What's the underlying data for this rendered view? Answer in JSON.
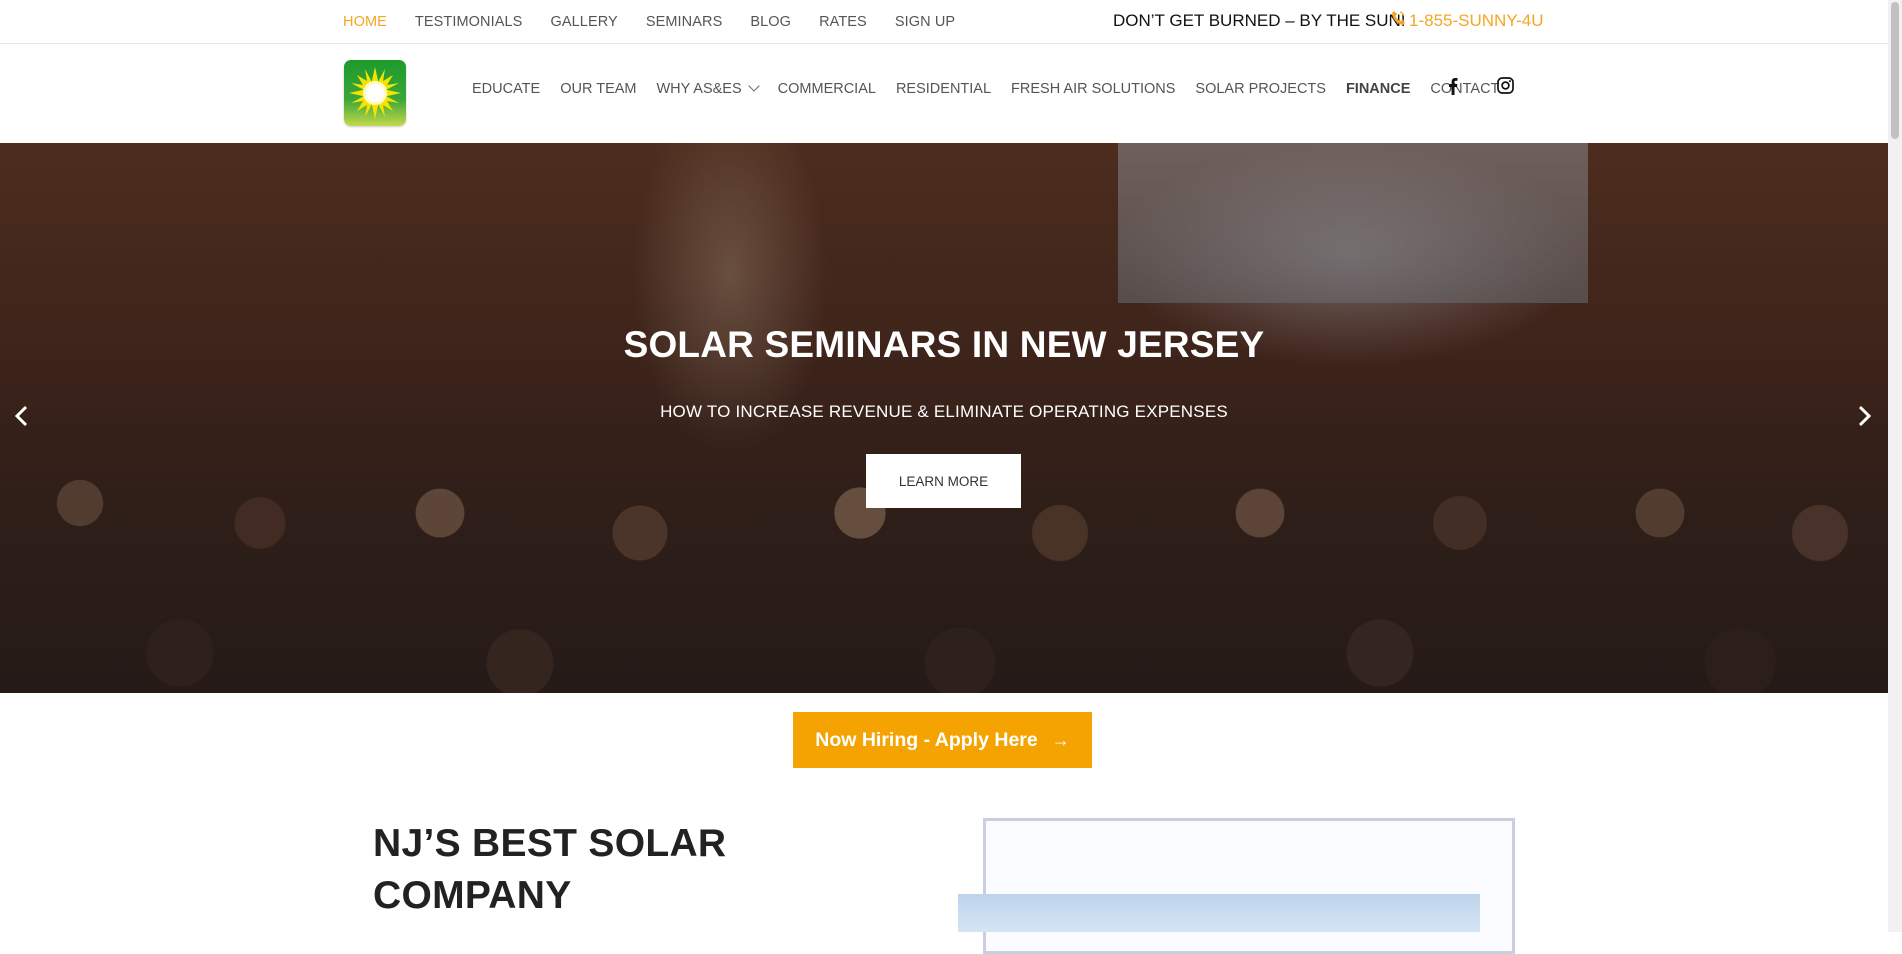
{
  "top_nav": {
    "items": [
      {
        "label": "HOME",
        "active": true
      },
      {
        "label": "TESTIMONIALS"
      },
      {
        "label": "GALLERY"
      },
      {
        "label": "SEMINARS"
      },
      {
        "label": "BLOG"
      },
      {
        "label": "RATES"
      },
      {
        "label": "SIGN UP"
      }
    ],
    "tagline": "DON’T GET BURNED – BY THE SUN!",
    "phone": "1-855-SUNNY-4U",
    "phone_icon": "phone-icon"
  },
  "main_nav": {
    "logo_icon": "sun-logo",
    "items": [
      {
        "label": "EDUCATE"
      },
      {
        "label": "OUR TEAM"
      },
      {
        "label": "WHY AS&ES"
      },
      {
        "label": "COMMERCIAL"
      },
      {
        "label": "RESIDENTIAL"
      },
      {
        "label": "FRESH AIR SOLUTIONS"
      },
      {
        "label": "SOLAR PROJECTS"
      },
      {
        "label": "FINANCE"
      },
      {
        "label": "CONTACT"
      }
    ],
    "social": [
      "facebook-icon",
      "instagram-icon"
    ]
  },
  "hero": {
    "title": "SOLAR SEMINARS IN NEW JERSEY",
    "subtitle": "HOW TO INCREASE REVENUE & ELIMINATE OPERATING EXPENSES",
    "button_label": "LEARN MORE"
  },
  "hiring": {
    "label": "Now Hiring - Apply Here",
    "arrow": "→"
  },
  "intro": {
    "title_line1": "NJ’S BEST SOLAR",
    "title_line2": "COMPANY"
  },
  "colors": {
    "accent": "#f5a623",
    "hire_button": "#f5a300"
  }
}
